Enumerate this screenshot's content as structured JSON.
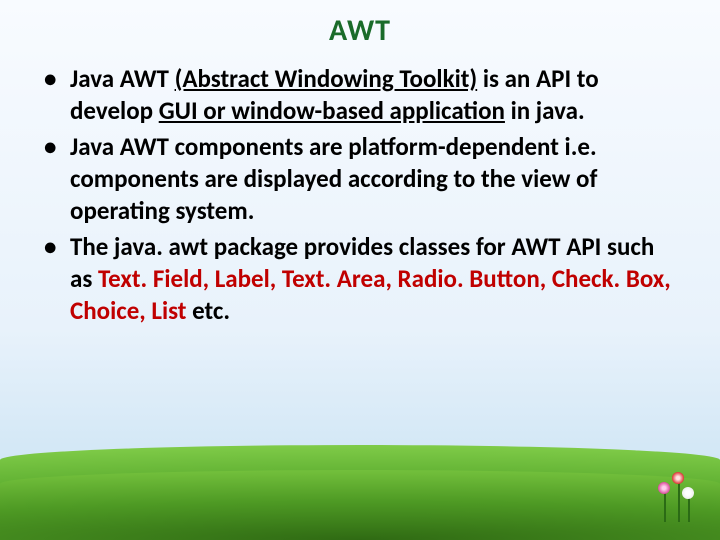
{
  "title": "AWT",
  "bullets": [
    {
      "pre": "Java AWT ",
      "u1": "(Abstract Windowing Toolkit)",
      "mid1": " is an API to develop ",
      "u2": "GUI or window-based application",
      "post": " in java."
    },
    {
      "full": "Java AWT components are platform-dependent i.e. components are displayed according to the view of operating system."
    },
    {
      "pre": "The java. awt package provides classes for AWT API such as ",
      "red": "Text. Field, Label, Text. Area, Radio. Button, Check. Box, Choice, List ",
      "post": "etc."
    }
  ]
}
